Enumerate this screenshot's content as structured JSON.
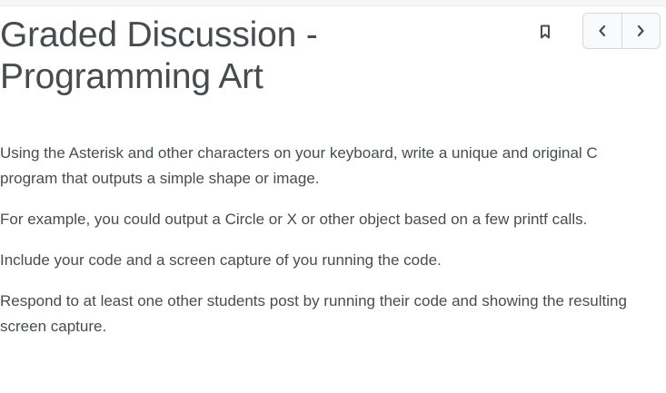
{
  "header": {
    "title": "Graded Discussion - Programming Art",
    "bookmark_icon": "bookmark-icon",
    "prev_icon": "chevron-left-icon",
    "next_icon": "chevron-right-icon"
  },
  "description": {
    "paragraphs": [
      "Using the Asterisk and other characters on your keyboard, write a unique and original C program that outputs a simple shape or image.",
      "For example, you could output a Circle or X or other object based on a few printf calls.",
      "Include your code and a screen capture of you running the code.",
      "Respond to at least one other students post by running their code and showing the resulting screen capture."
    ]
  },
  "colors": {
    "text": "#494c4e",
    "border": "#d3d9e3"
  }
}
